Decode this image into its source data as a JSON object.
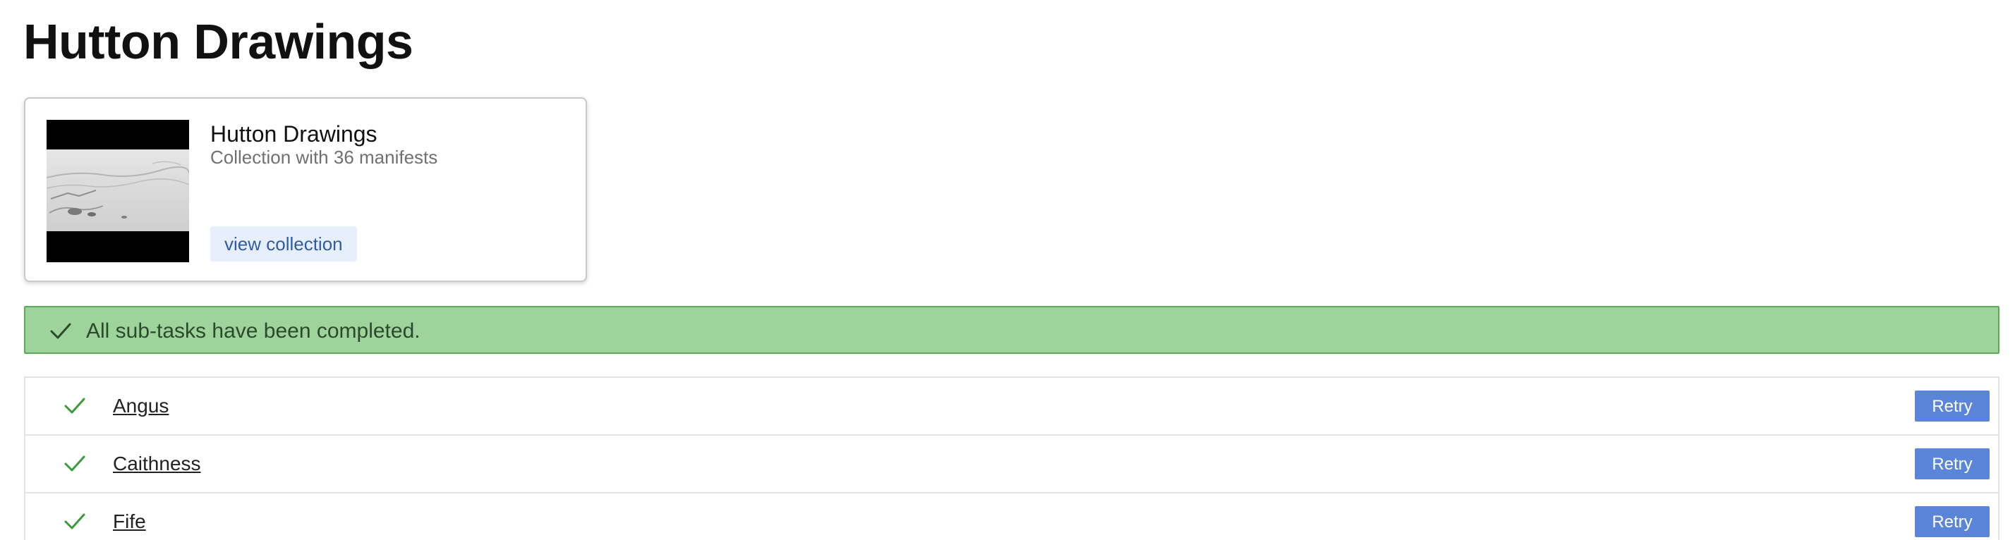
{
  "page": {
    "title": "Hutton Drawings"
  },
  "collection_card": {
    "title": "Hutton Drawings",
    "subtitle": "Collection with 36 manifests",
    "view_label": "view collection"
  },
  "banner": {
    "message": "All sub-tasks have been completed.",
    "icon": "check-icon",
    "color": "#9ed49c"
  },
  "tasks": [
    {
      "name": "Angus",
      "status_icon": "check-icon",
      "action_label": "Retry"
    },
    {
      "name": "Caithness",
      "status_icon": "check-icon",
      "action_label": "Retry"
    },
    {
      "name": "Fife",
      "status_icon": "check-icon",
      "action_label": "Retry"
    }
  ],
  "colors": {
    "accent": "#5b85d8",
    "success": "#3c9a3c"
  }
}
